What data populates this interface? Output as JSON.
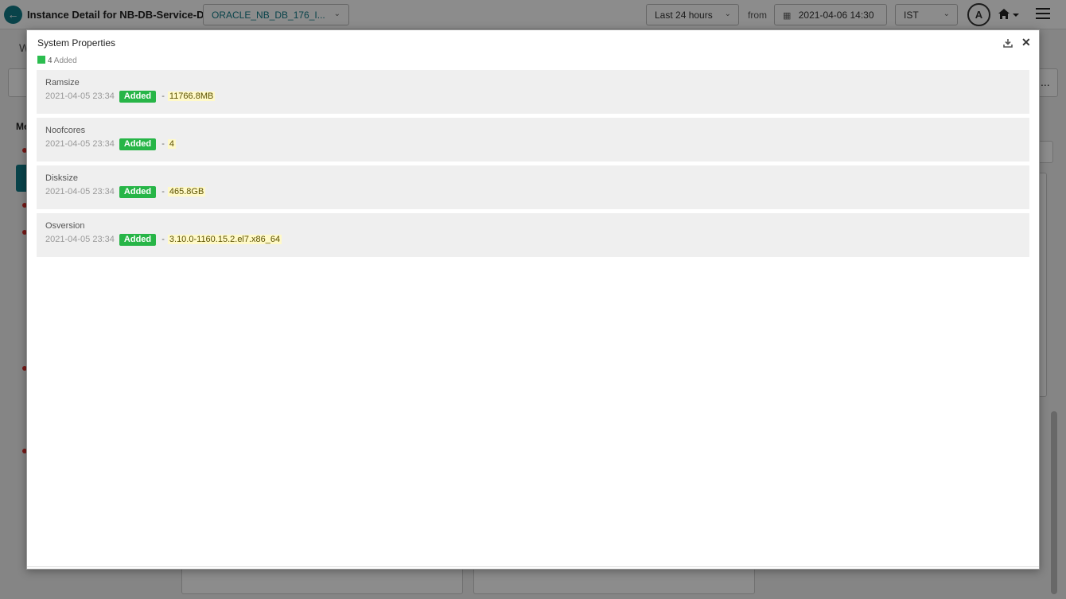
{
  "header": {
    "title": "Instance Detail for NB-DB-Service-DR",
    "instance_select": "ORACLE_NB_DB_176_I...",
    "time_range": "Last 24 hours",
    "from_label": "from",
    "from_date": "2021-04-06 14:30",
    "timezone": "IST",
    "avatar_initial": "A"
  },
  "modal": {
    "title": "System Properties",
    "summary_count": "4",
    "summary_label": "Added",
    "items": [
      {
        "name": "Ramsize",
        "timestamp": "2021-04-05 23:34",
        "badge": "Added",
        "sep": "-",
        "value": "11766.8MB"
      },
      {
        "name": "Noofcores",
        "timestamp": "2021-04-05 23:34",
        "badge": "Added",
        "sep": "-",
        "value": "4"
      },
      {
        "name": "Disksize",
        "timestamp": "2021-04-05 23:34",
        "badge": "Added",
        "sep": "-",
        "value": "465.8GB"
      },
      {
        "name": "Osversion",
        "timestamp": "2021-04-05 23:34",
        "badge": "Added",
        "sep": "-",
        "value": "3.10.0-1160.15.2.el7.x86_64"
      }
    ]
  },
  "colors": {
    "accent": "#127a88",
    "added_green": "#27b547",
    "value_highlight": "#fff9c8"
  }
}
